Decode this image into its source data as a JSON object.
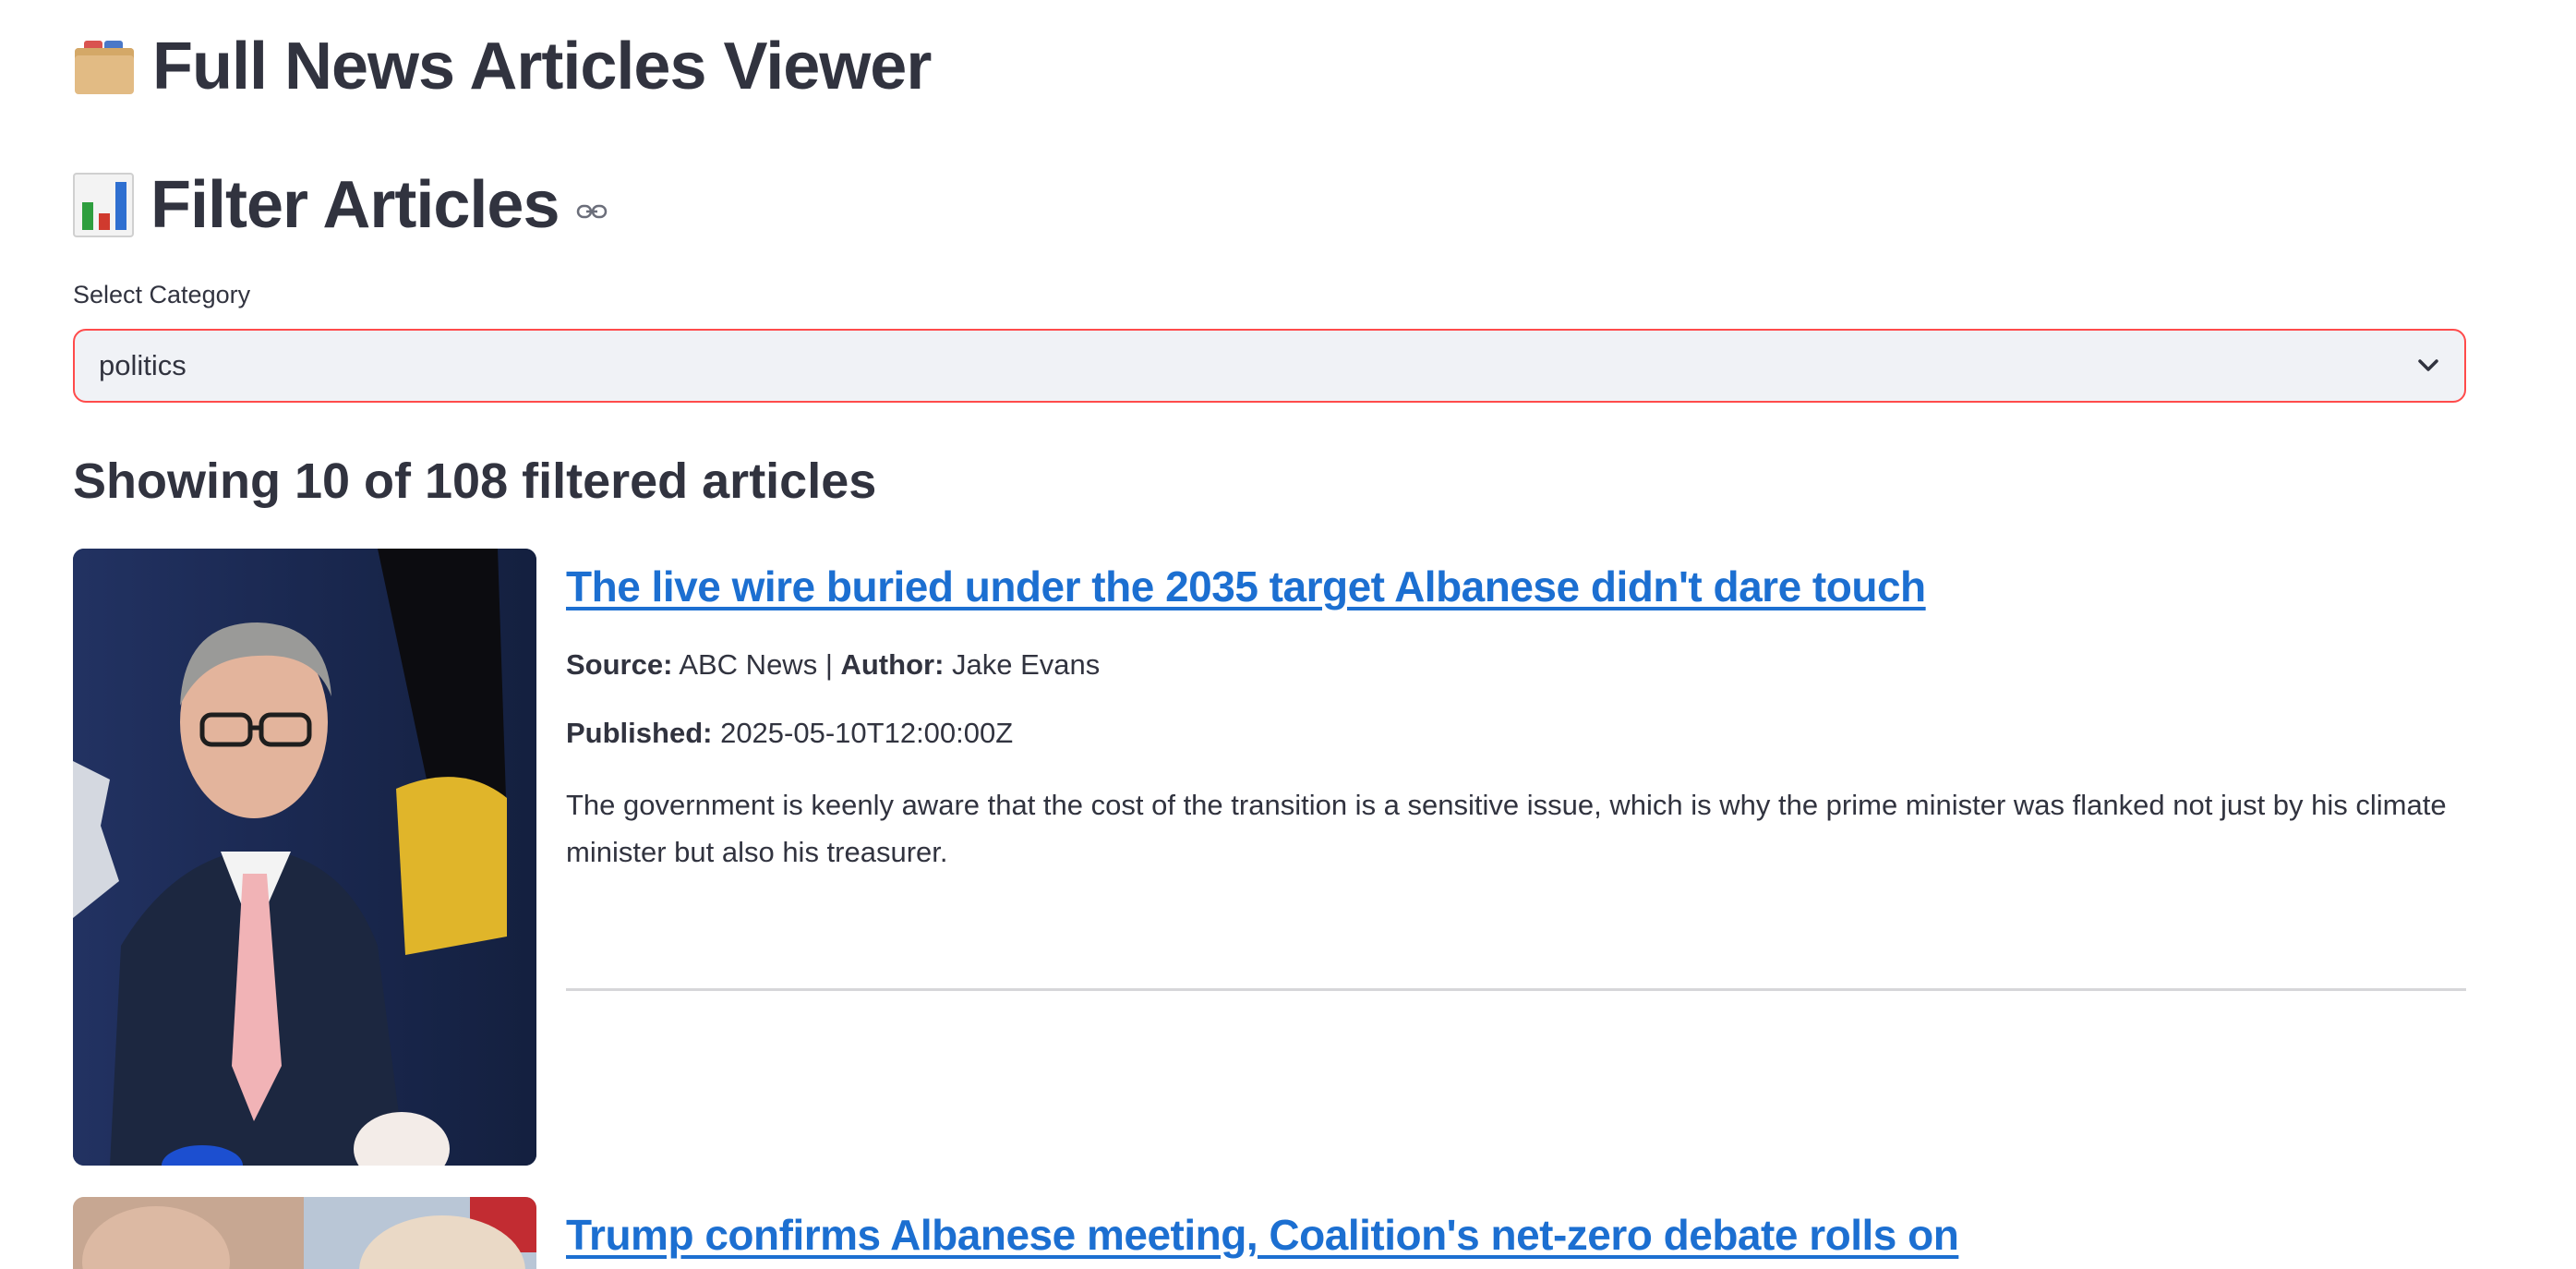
{
  "header": {
    "title": "Full News Articles Viewer",
    "icon": "card-file-box-icon"
  },
  "filter": {
    "title": "Filter Articles",
    "icon": "bar-chart-icon",
    "select_label": "Select Category",
    "selected_value": "politics"
  },
  "summary": {
    "text": "Showing 10 of 108 filtered articles"
  },
  "labels": {
    "source": "Source:",
    "author": "Author:",
    "published": "Published:",
    "separator": " | "
  },
  "articles": [
    {
      "title": "The live wire buried under the 2035 target Albanese didn't dare touch",
      "source": "ABC News",
      "author": "Jake Evans",
      "published": "2025-05-10T12:00:00Z",
      "description": "The government is keenly aware that the cost of the transition is a sensitive issue, which is why the prime minister was flanked not just by his climate minister but also his treasurer."
    },
    {
      "title": "Trump confirms Albanese meeting, Coalition's net-zero debate rolls on"
    }
  ],
  "colors": {
    "accent": "#ff4b4b",
    "link": "#1c6fd1",
    "text": "#31333f",
    "select_bg": "#f0f2f6"
  }
}
